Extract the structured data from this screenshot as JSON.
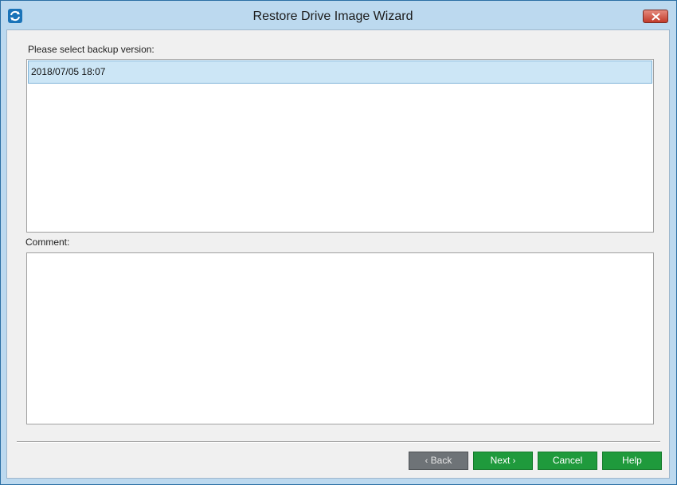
{
  "window": {
    "title": "Restore Drive Image Wizard"
  },
  "backup": {
    "label": "Please select backup version:",
    "versions": [
      "2018/07/05 18:07"
    ],
    "selected_index": 0
  },
  "comment": {
    "label": "Comment:",
    "value": ""
  },
  "buttons": {
    "back_chevron": "‹",
    "back_label": "Back",
    "next_label": "Next",
    "next_chevron": "›",
    "cancel_label": "Cancel",
    "help_label": "Help"
  },
  "icons": {
    "app": "sync-icon",
    "close": "close-icon"
  },
  "colors": {
    "titlebar": "#bcd9ef",
    "selection": "#cce6f6",
    "primary_button": "#1f9a3c",
    "disabled_button": "#6e7377",
    "close_button": "#c23b2a"
  }
}
